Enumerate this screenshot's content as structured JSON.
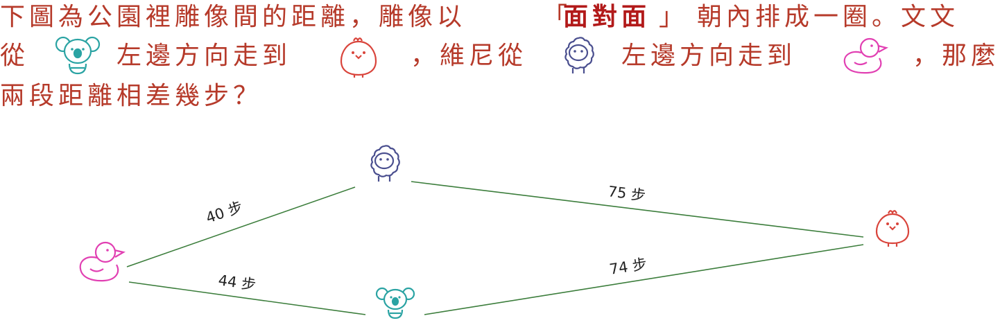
{
  "question": {
    "line1": {
      "part1": "下圖為公園裡雕像間的距離，雕像以",
      "bracket_open": "「",
      "emphasis": "面對面",
      "bracket_close": "」",
      "part2": "朝內排成一圈。文文"
    },
    "line2": {
      "part1": "從",
      "part2": "左邊方向走到",
      "part3": "，維尼從",
      "part4": "左邊方向走到",
      "part5": "，那麼"
    },
    "line3": "兩段距離相差幾步？"
  },
  "statues": [
    {
      "id": "koala",
      "icon": "koala-icon"
    },
    {
      "id": "chick",
      "icon": "chick-icon"
    },
    {
      "id": "sheep",
      "icon": "sheep-icon"
    },
    {
      "id": "duck",
      "icon": "duck-icon"
    }
  ],
  "edges": [
    {
      "from": "duck",
      "to": "sheep",
      "label": "40 步"
    },
    {
      "from": "sheep",
      "to": "chick",
      "label": "75 步"
    },
    {
      "from": "duck",
      "to": "koala",
      "label": "44 步"
    },
    {
      "from": "koala",
      "to": "chick",
      "label": "74 步"
    }
  ],
  "colors": {
    "text": "#b63a2a",
    "edge": "#3b7d3b",
    "koala": "#2aa3a3",
    "chick": "#d9443b",
    "sheep": "#4a4f8f",
    "duck": "#e13fb2"
  }
}
